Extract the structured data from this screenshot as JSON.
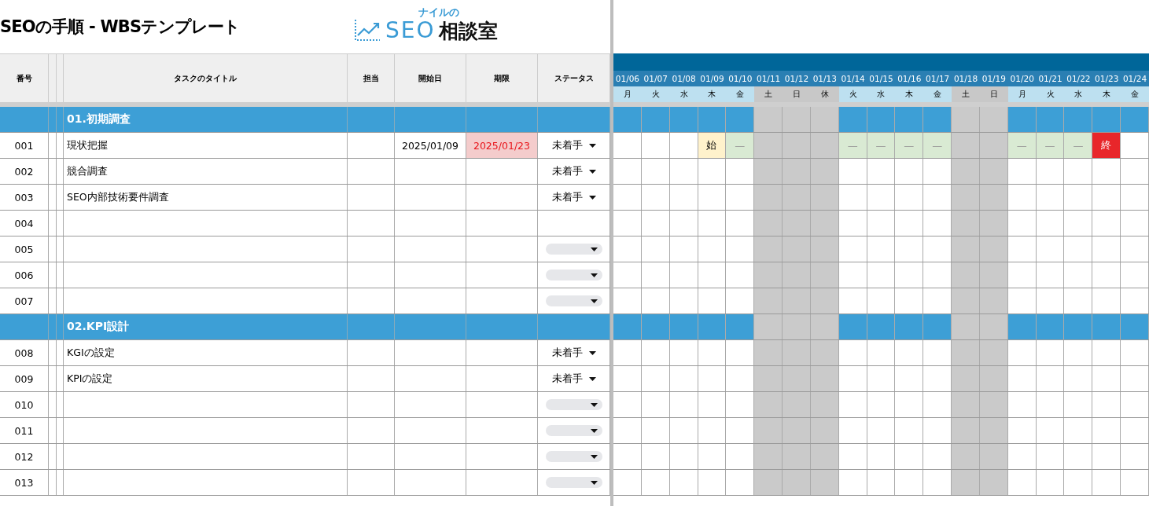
{
  "title": "SEOの手順 - WBSテンプレート",
  "logo": {
    "top": "ナイルの",
    "brand": "SEO",
    "suffix": "相談室"
  },
  "columns": [
    "番号",
    "タスクのタイトル",
    "担当",
    "開始日",
    "期限",
    "ステータス"
  ],
  "days": [
    {
      "date": "01/06",
      "weekday": "月",
      "holiday": false
    },
    {
      "date": "01/07",
      "weekday": "火",
      "holiday": false
    },
    {
      "date": "01/08",
      "weekday": "水",
      "holiday": false
    },
    {
      "date": "01/09",
      "weekday": "木",
      "holiday": false
    },
    {
      "date": "01/10",
      "weekday": "金",
      "holiday": false
    },
    {
      "date": "01/11",
      "weekday": "土",
      "holiday": true
    },
    {
      "date": "01/12",
      "weekday": "日",
      "holiday": true
    },
    {
      "date": "01/13",
      "weekday": "休",
      "holiday": true
    },
    {
      "date": "01/14",
      "weekday": "火",
      "holiday": false
    },
    {
      "date": "01/15",
      "weekday": "水",
      "holiday": false
    },
    {
      "date": "01/16",
      "weekday": "木",
      "holiday": false
    },
    {
      "date": "01/17",
      "weekday": "金",
      "holiday": false
    },
    {
      "date": "01/18",
      "weekday": "土",
      "holiday": true
    },
    {
      "date": "01/19",
      "weekday": "日",
      "holiday": true
    },
    {
      "date": "01/20",
      "weekday": "月",
      "holiday": false
    },
    {
      "date": "01/21",
      "weekday": "火",
      "holiday": false
    },
    {
      "date": "01/22",
      "weekday": "水",
      "holiday": false
    },
    {
      "date": "01/23",
      "weekday": "木",
      "holiday": false
    },
    {
      "date": "01/24",
      "weekday": "金",
      "holiday": false
    }
  ],
  "rows": [
    {
      "kind": "section",
      "title": "01.初期調査"
    },
    {
      "kind": "task",
      "number": "001",
      "title": "現状把握",
      "start": "2025/01/09",
      "deadline": "2025/01/23",
      "overdue": true,
      "dropdown": true,
      "status": "未着手",
      "gantt": [
        {
          "kind": "none"
        },
        {
          "kind": "none"
        },
        {
          "kind": "none"
        },
        {
          "kind": "start",
          "text": "始"
        },
        {
          "kind": "mid",
          "text": "—"
        },
        {
          "kind": "none"
        },
        {
          "kind": "none"
        },
        {
          "kind": "none"
        },
        {
          "kind": "mid",
          "text": "—"
        },
        {
          "kind": "mid",
          "text": "—"
        },
        {
          "kind": "mid",
          "text": "—"
        },
        {
          "kind": "mid",
          "text": "—"
        },
        {
          "kind": "none"
        },
        {
          "kind": "none"
        },
        {
          "kind": "mid",
          "text": "—"
        },
        {
          "kind": "mid",
          "text": "—"
        },
        {
          "kind": "mid",
          "text": "—"
        },
        {
          "kind": "end",
          "text": "終"
        },
        {
          "kind": "none"
        }
      ]
    },
    {
      "kind": "task",
      "number": "002",
      "title": "競合調査",
      "dropdown": true,
      "status": "未着手"
    },
    {
      "kind": "task",
      "number": "003",
      "title": "SEO内部技術要件調査",
      "dropdown": true,
      "status": "未着手"
    },
    {
      "kind": "task",
      "number": "004"
    },
    {
      "kind": "task",
      "number": "005",
      "dropdown": true
    },
    {
      "kind": "task",
      "number": "006",
      "dropdown": true
    },
    {
      "kind": "task",
      "number": "007",
      "dropdown": true
    },
    {
      "kind": "section",
      "title": "02.KPI設計"
    },
    {
      "kind": "task",
      "number": "008",
      "title": "KGIの設定",
      "dropdown": true,
      "status": "未着手"
    },
    {
      "kind": "task",
      "number": "009",
      "title": "KPIの設定",
      "dropdown": true,
      "status": "未着手"
    },
    {
      "kind": "task",
      "number": "010",
      "dropdown": true
    },
    {
      "kind": "task",
      "number": "011",
      "dropdown": true
    },
    {
      "kind": "task",
      "number": "012",
      "dropdown": true
    },
    {
      "kind": "task",
      "number": "013",
      "dropdown": true
    }
  ]
}
